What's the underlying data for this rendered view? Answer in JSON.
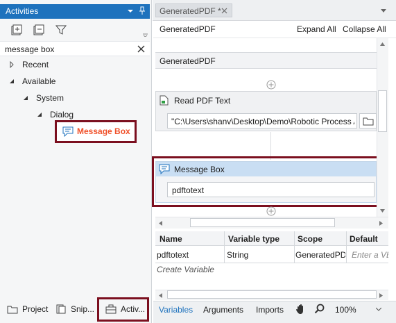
{
  "activities_panel": {
    "title": "Activities",
    "search_value": "message box",
    "tree": {
      "recent": "Recent",
      "available": "Available",
      "system": "System",
      "dialog": "Dialog",
      "message_box": "Message Box"
    },
    "bottom_tabs": {
      "project": "Project",
      "snippets": "Snip...",
      "activities": "Activ..."
    }
  },
  "designer": {
    "tab_title": "GeneratedPDF *",
    "breadcrumb": "GeneratedPDF",
    "expand_all": "Expand All",
    "collapse_all": "Collapse All",
    "sequence_title": "GeneratedPDF",
    "read_pdf": {
      "title": "Read PDF Text",
      "file_value": "\"C:\\Users\\shanv\\Desktop\\Demo\\Robotic Process A"
    },
    "message_box": {
      "title": "Message Box",
      "text_value": "pdftotext"
    }
  },
  "variables": {
    "headers": [
      "Name",
      "Variable type",
      "Scope",
      "Default"
    ],
    "rows": [
      {
        "name": "pdftotext",
        "type": "String",
        "scope": "GeneratedPDF",
        "default_placeholder": "Enter a VB"
      }
    ],
    "create_label": "Create Variable"
  },
  "designer_tabs": {
    "variables": "Variables",
    "arguments": "Arguments",
    "imports": "Imports",
    "zoom": "100%"
  },
  "colors": {
    "accent": "#1e72bd",
    "highlight_box": "#7b0f1f",
    "activity_orange": "#f0512a",
    "selected_header": "#c9def3"
  }
}
